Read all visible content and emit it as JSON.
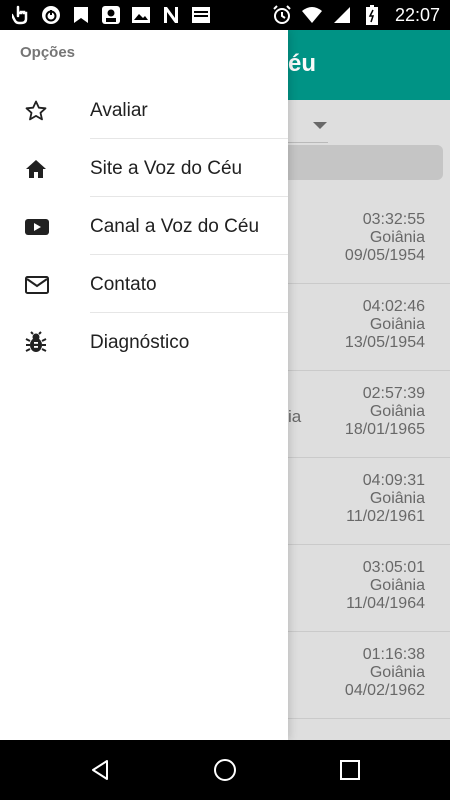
{
  "status_bar": {
    "time": "22:07",
    "left_icons": [
      "hand-icon",
      "power-icon",
      "bookmark-icon",
      "person-app-icon",
      "image-icon",
      "n-app-icon",
      "bible-app-icon"
    ],
    "right_icons": [
      "alarm-icon",
      "wifi-icon",
      "cellular-icon",
      "battery-icon"
    ]
  },
  "background": {
    "title_partial": "éu",
    "list": [
      {
        "time": "03:32:55",
        "city": "Goiânia",
        "date": "09/05/1954",
        "trail": ""
      },
      {
        "time": "04:02:46",
        "city": "Goiânia",
        "date": "13/05/1954",
        "trail": ""
      },
      {
        "time": "02:57:39",
        "city": "Goiânia",
        "date": "18/01/1965",
        "trail": "ia"
      },
      {
        "time": "04:09:31",
        "city": "Goiânia",
        "date": "11/02/1961",
        "trail": ""
      },
      {
        "time": "03:05:01",
        "city": "Goiânia",
        "date": "11/04/1964",
        "trail": ""
      },
      {
        "time": "01:16:38",
        "city": "Goiânia",
        "date": "04/02/1962",
        "trail": ""
      }
    ]
  },
  "drawer": {
    "header": "Opções",
    "items": [
      {
        "label": "Avaliar",
        "icon": "star-icon"
      },
      {
        "label": "Site a Voz do Céu",
        "icon": "home-icon"
      },
      {
        "label": "Canal a Voz do Céu",
        "icon": "youtube-icon"
      },
      {
        "label": "Contato",
        "icon": "mail-icon"
      },
      {
        "label": "Diagnóstico",
        "icon": "bug-icon"
      }
    ]
  },
  "colors": {
    "toolbar": "#009688",
    "drawer_bg": "#ffffff",
    "text_primary": "#212121",
    "text_secondary": "#757575"
  }
}
